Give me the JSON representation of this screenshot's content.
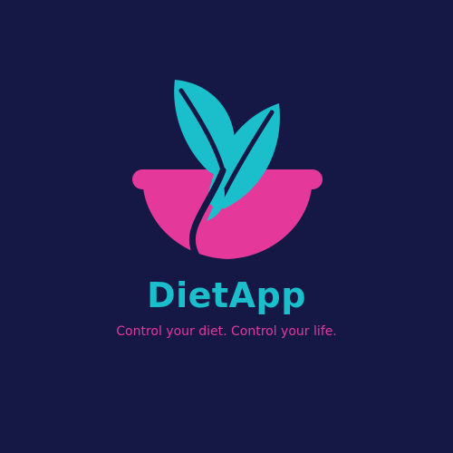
{
  "brand": {
    "name": "DietApp",
    "tagline": "Control your diet. Control your life."
  },
  "logo": {
    "icon": "bowl-with-leaves-icon",
    "bowl_color": "#E4399A",
    "leaf_color": "#1ABFCB",
    "background_color": "#151745"
  }
}
